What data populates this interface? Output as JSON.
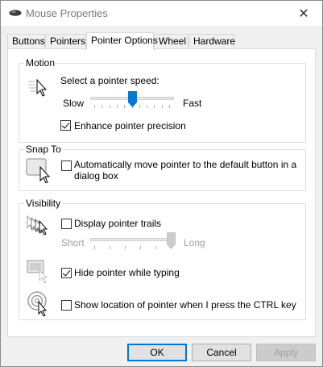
{
  "window": {
    "title": "Mouse Properties",
    "close_glyph": "✕"
  },
  "tabs": [
    {
      "label": "Buttons"
    },
    {
      "label": "Pointers"
    },
    {
      "label": "Pointer Options"
    },
    {
      "label": "Wheel"
    },
    {
      "label": "Hardware"
    }
  ],
  "active_tab": "Pointer Options",
  "motion": {
    "title": "Motion",
    "speed_label": "Select a pointer speed:",
    "slow_label": "Slow",
    "fast_label": "Fast",
    "speed_level": 0.5,
    "enhance_label": "Enhance pointer precision",
    "enhance_checked": true
  },
  "snap_to": {
    "title": "Snap To",
    "snap_label_line1": "Automatically move pointer to the default button in a",
    "snap_label_line2": "dialog box",
    "snap_checked": false
  },
  "visibility": {
    "title": "Visibility",
    "trails_label": "Display pointer trails",
    "trails_checked": false,
    "short_label": "Short",
    "long_label": "Long",
    "trail_length_level": 1.0,
    "hide_label": "Hide pointer while typing",
    "hide_checked": true,
    "ctrl_label": "Show location of pointer when I press the CTRL key",
    "ctrl_checked": false
  },
  "buttons": {
    "ok_label": "OK",
    "cancel_label": "Cancel",
    "apply_label": "Apply"
  },
  "colors": {
    "accent": "#0078d7",
    "disabled_text": "#a0a0a0"
  }
}
